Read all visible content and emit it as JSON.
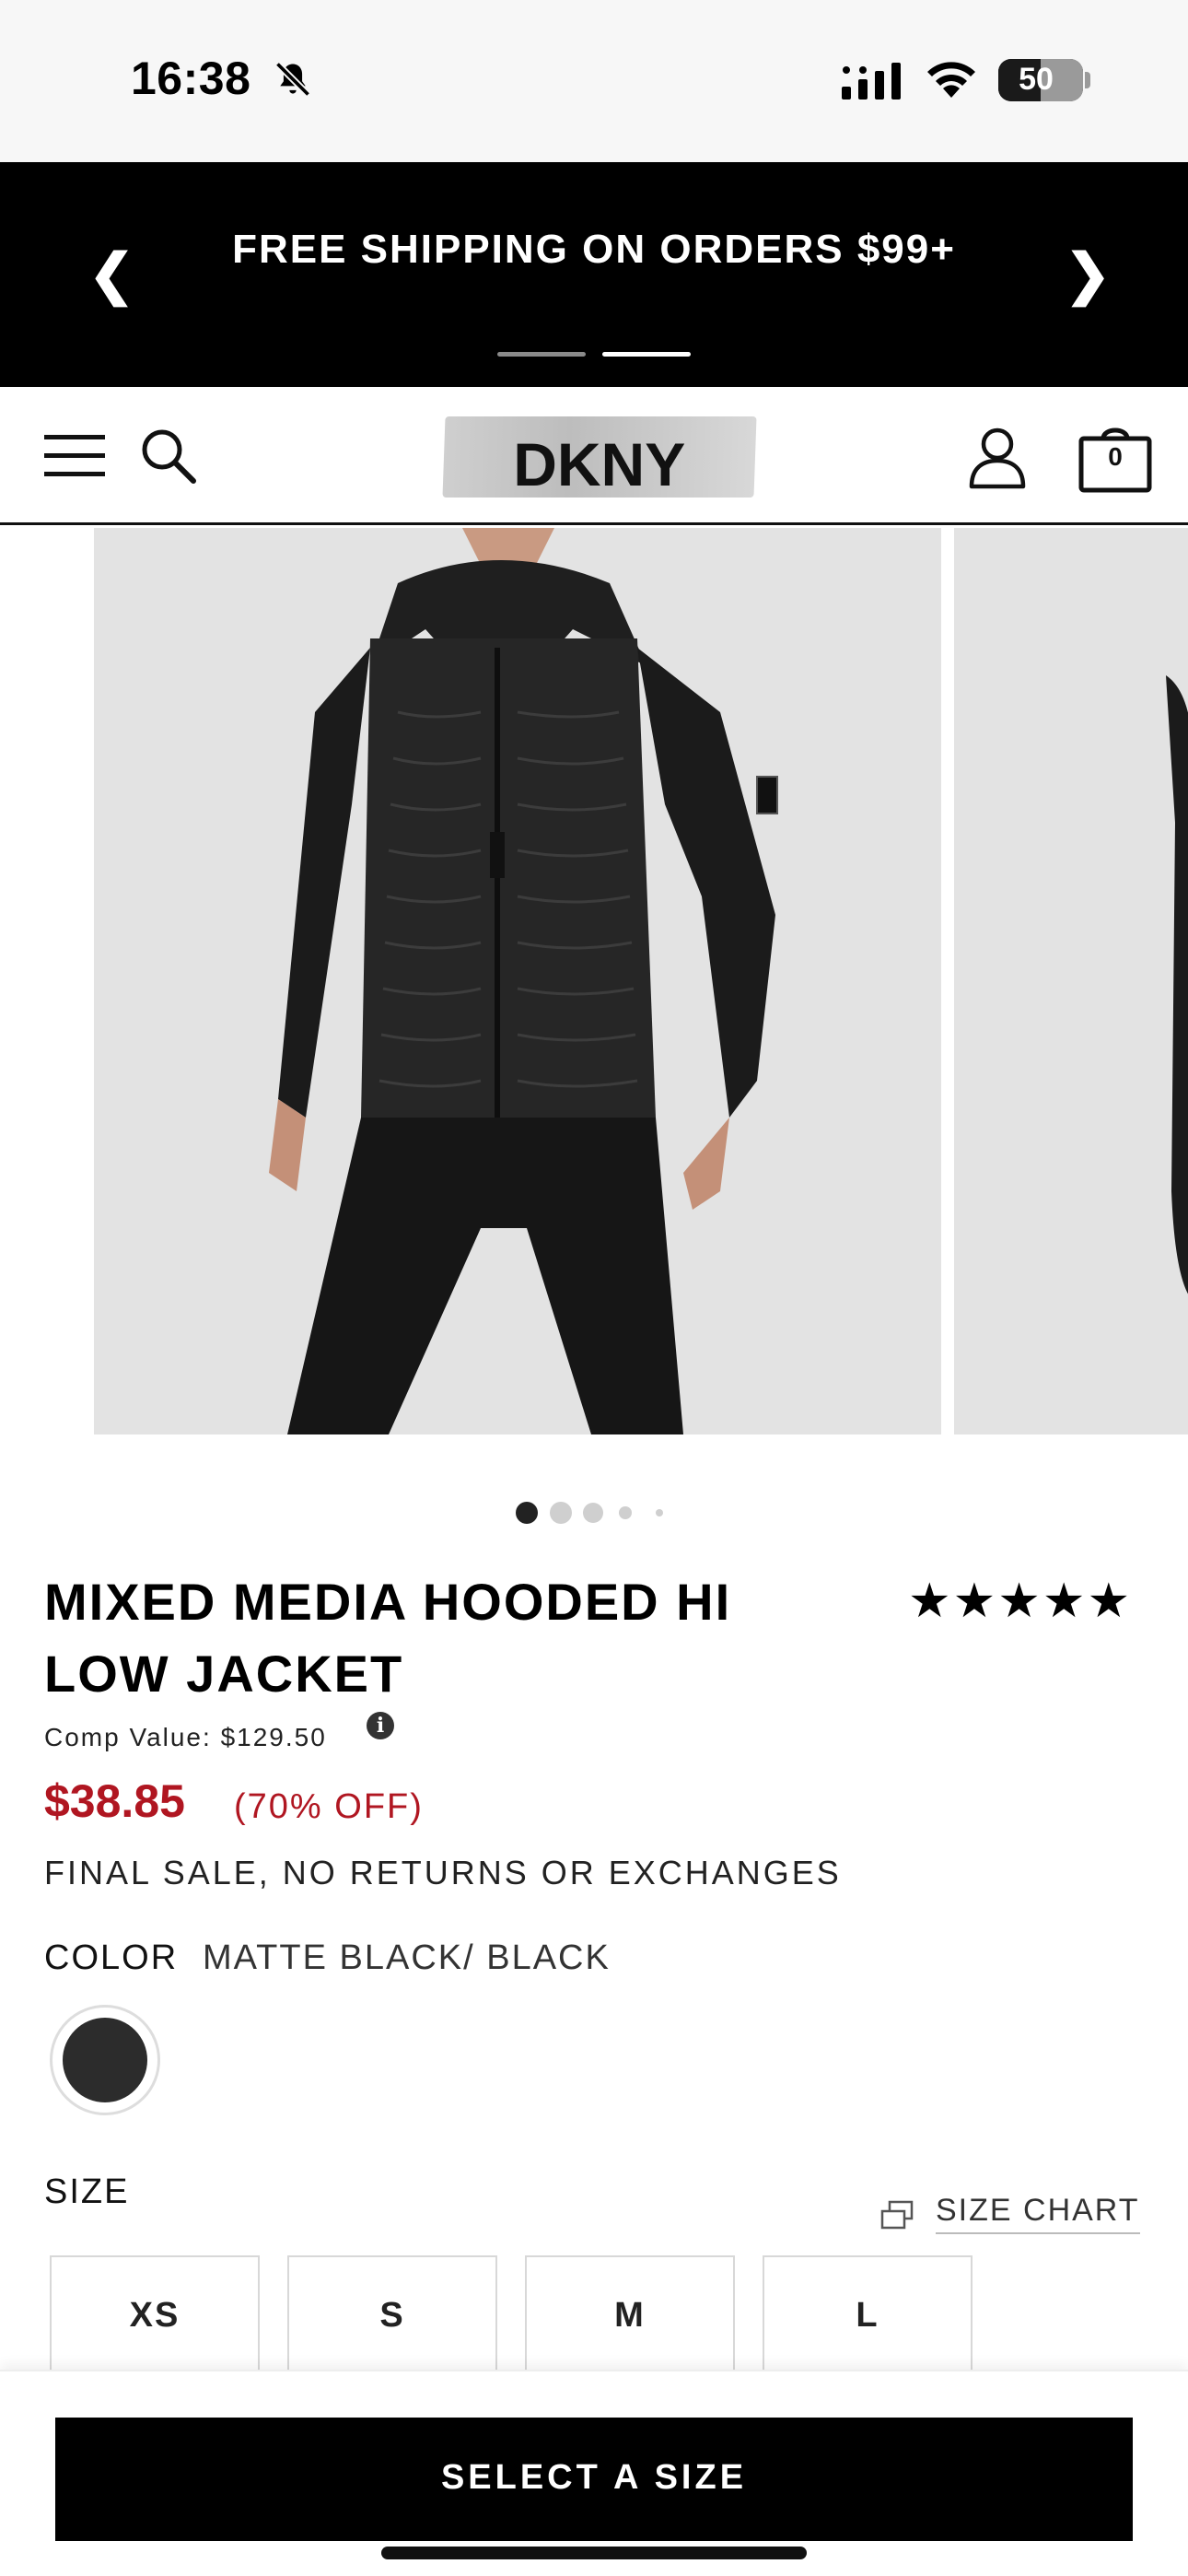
{
  "status_bar": {
    "time": "16:38",
    "battery": "50"
  },
  "promo": {
    "text": "FREE SHIPPING ON ORDERS $99+",
    "prev": "❮",
    "next": "❯"
  },
  "header": {
    "logo": "DKNY",
    "bag_count": "0"
  },
  "product": {
    "title": "MIXED MEDIA HOODED HI LOW JACKET",
    "rating_stars": "★★★★★",
    "comp_value": "Comp Value: $129.50",
    "info_icon": "i",
    "price": "$38.85",
    "discount": "(70% OFF)",
    "final_sale": "FINAL SALE, NO RETURNS OR EXCHANGES",
    "color_label": "COLOR",
    "color_value": "MATTE BLACK/ BLACK",
    "swatch_color": "#2c2c2c",
    "size_label": "SIZE",
    "size_chart": "SIZE CHART",
    "sizes": [
      "XS",
      "S",
      "M",
      "L"
    ]
  },
  "carousel": {
    "current": 1,
    "total": 5
  },
  "cta": {
    "label": "SELECT A SIZE"
  },
  "colors": {
    "sale_red": "#b01621",
    "black": "#000000"
  }
}
